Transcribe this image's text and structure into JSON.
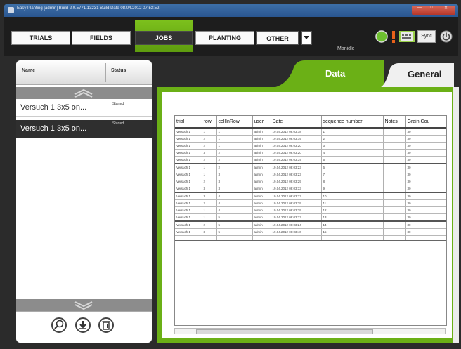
{
  "window": {
    "title": "Easy Planting [admin] Build 2.0.5771.13231 Build Date 08.04.2012 07:53:52"
  },
  "nav": {
    "tabs": [
      {
        "label": "TRIALS"
      },
      {
        "label": "FIELDS"
      },
      {
        "label": "JOBS"
      },
      {
        "label": "PLANTING"
      },
      {
        "label": "OTHER"
      }
    ],
    "active": "JOBS"
  },
  "toolbar": {
    "status_text": "Manidle",
    "sync_label": "Sync",
    "icons": [
      "status-green-icon",
      "alert-icon",
      "keyboard-icon",
      "sync-icon",
      "power-icon"
    ]
  },
  "jobs_panel": {
    "columns": [
      "Name",
      "Status"
    ],
    "items": [
      {
        "name": "Versuch 1 3x5 on...",
        "status": "Started",
        "selected": false
      },
      {
        "name": "Versuch 1 3x5 on...",
        "status": "Started",
        "selected": true
      }
    ],
    "footer_icons": [
      "search-icon",
      "download-icon",
      "delete-icon"
    ]
  },
  "detail_tabs": [
    {
      "label": "Data",
      "active": true
    },
    {
      "label": "General",
      "active": false
    }
  ],
  "data_table": {
    "columns": [
      "trial",
      "row",
      "cellInRow",
      "user",
      "Date",
      "sequence number",
      "Notes",
      "Grain Cou"
    ],
    "rows": [
      [
        "Versuch 1",
        "1",
        "1",
        "admin",
        "19.04.2012 08:03:18",
        "1",
        "",
        "30"
      ],
      [
        "Versuch 1",
        "2",
        "1",
        "admin",
        "19.04.2012 08:03:19",
        "2",
        "",
        "30"
      ],
      [
        "Versuch 1",
        "2",
        "1",
        "admin",
        "19.04.2012 08:03:20",
        "3",
        "",
        "30"
      ],
      [
        "Versuch 1",
        "3",
        "2",
        "admin",
        "19.04.2012 08:03:20",
        "4",
        "",
        "30"
      ],
      [
        "Versuch 1",
        "2",
        "2",
        "admin",
        "19.04.2012 08:03:34",
        "5",
        "",
        "30"
      ],
      [
        "Versuch 1",
        "1",
        "2",
        "admin",
        "19.04.2012 08:03:23",
        "6",
        "",
        "30"
      ],
      [
        "Versuch 1",
        "1",
        "3",
        "admin",
        "19.04.2012 08:03:23",
        "7",
        "",
        "30"
      ],
      [
        "Versuch 1",
        "2",
        "3",
        "admin",
        "19.04.2012 08:03:29",
        "8",
        "",
        "30"
      ],
      [
        "Versuch 1",
        "3",
        "3",
        "admin",
        "19.04.2012 08:03:33",
        "9",
        "",
        "30"
      ],
      [
        "Versuch 1",
        "3",
        "4",
        "admin",
        "19.04.2012 08:03:33",
        "10",
        "",
        "30"
      ],
      [
        "Versuch 1",
        "2",
        "4",
        "admin",
        "19.04.2012 08:03:29",
        "11",
        "",
        "30"
      ],
      [
        "Versuch 1",
        "1",
        "4",
        "admin",
        "19.04.2012 08:03:29",
        "12",
        "",
        "30"
      ],
      [
        "Versuch 1",
        "1",
        "5",
        "admin",
        "19.04.2012 08:03:33",
        "13",
        "",
        "30"
      ],
      [
        "Versuch 1",
        "2",
        "5",
        "admin",
        "19.04.2012 08:03:24",
        "14",
        "",
        "30"
      ],
      [
        "Versuch 1",
        "3",
        "5",
        "admin",
        "19.04.2012 08:03:40",
        "15",
        "",
        "30"
      ]
    ]
  },
  "colors": {
    "accent_green": "#6bb016",
    "background": "#2b2b2b",
    "title_bar": "#2a5690"
  }
}
